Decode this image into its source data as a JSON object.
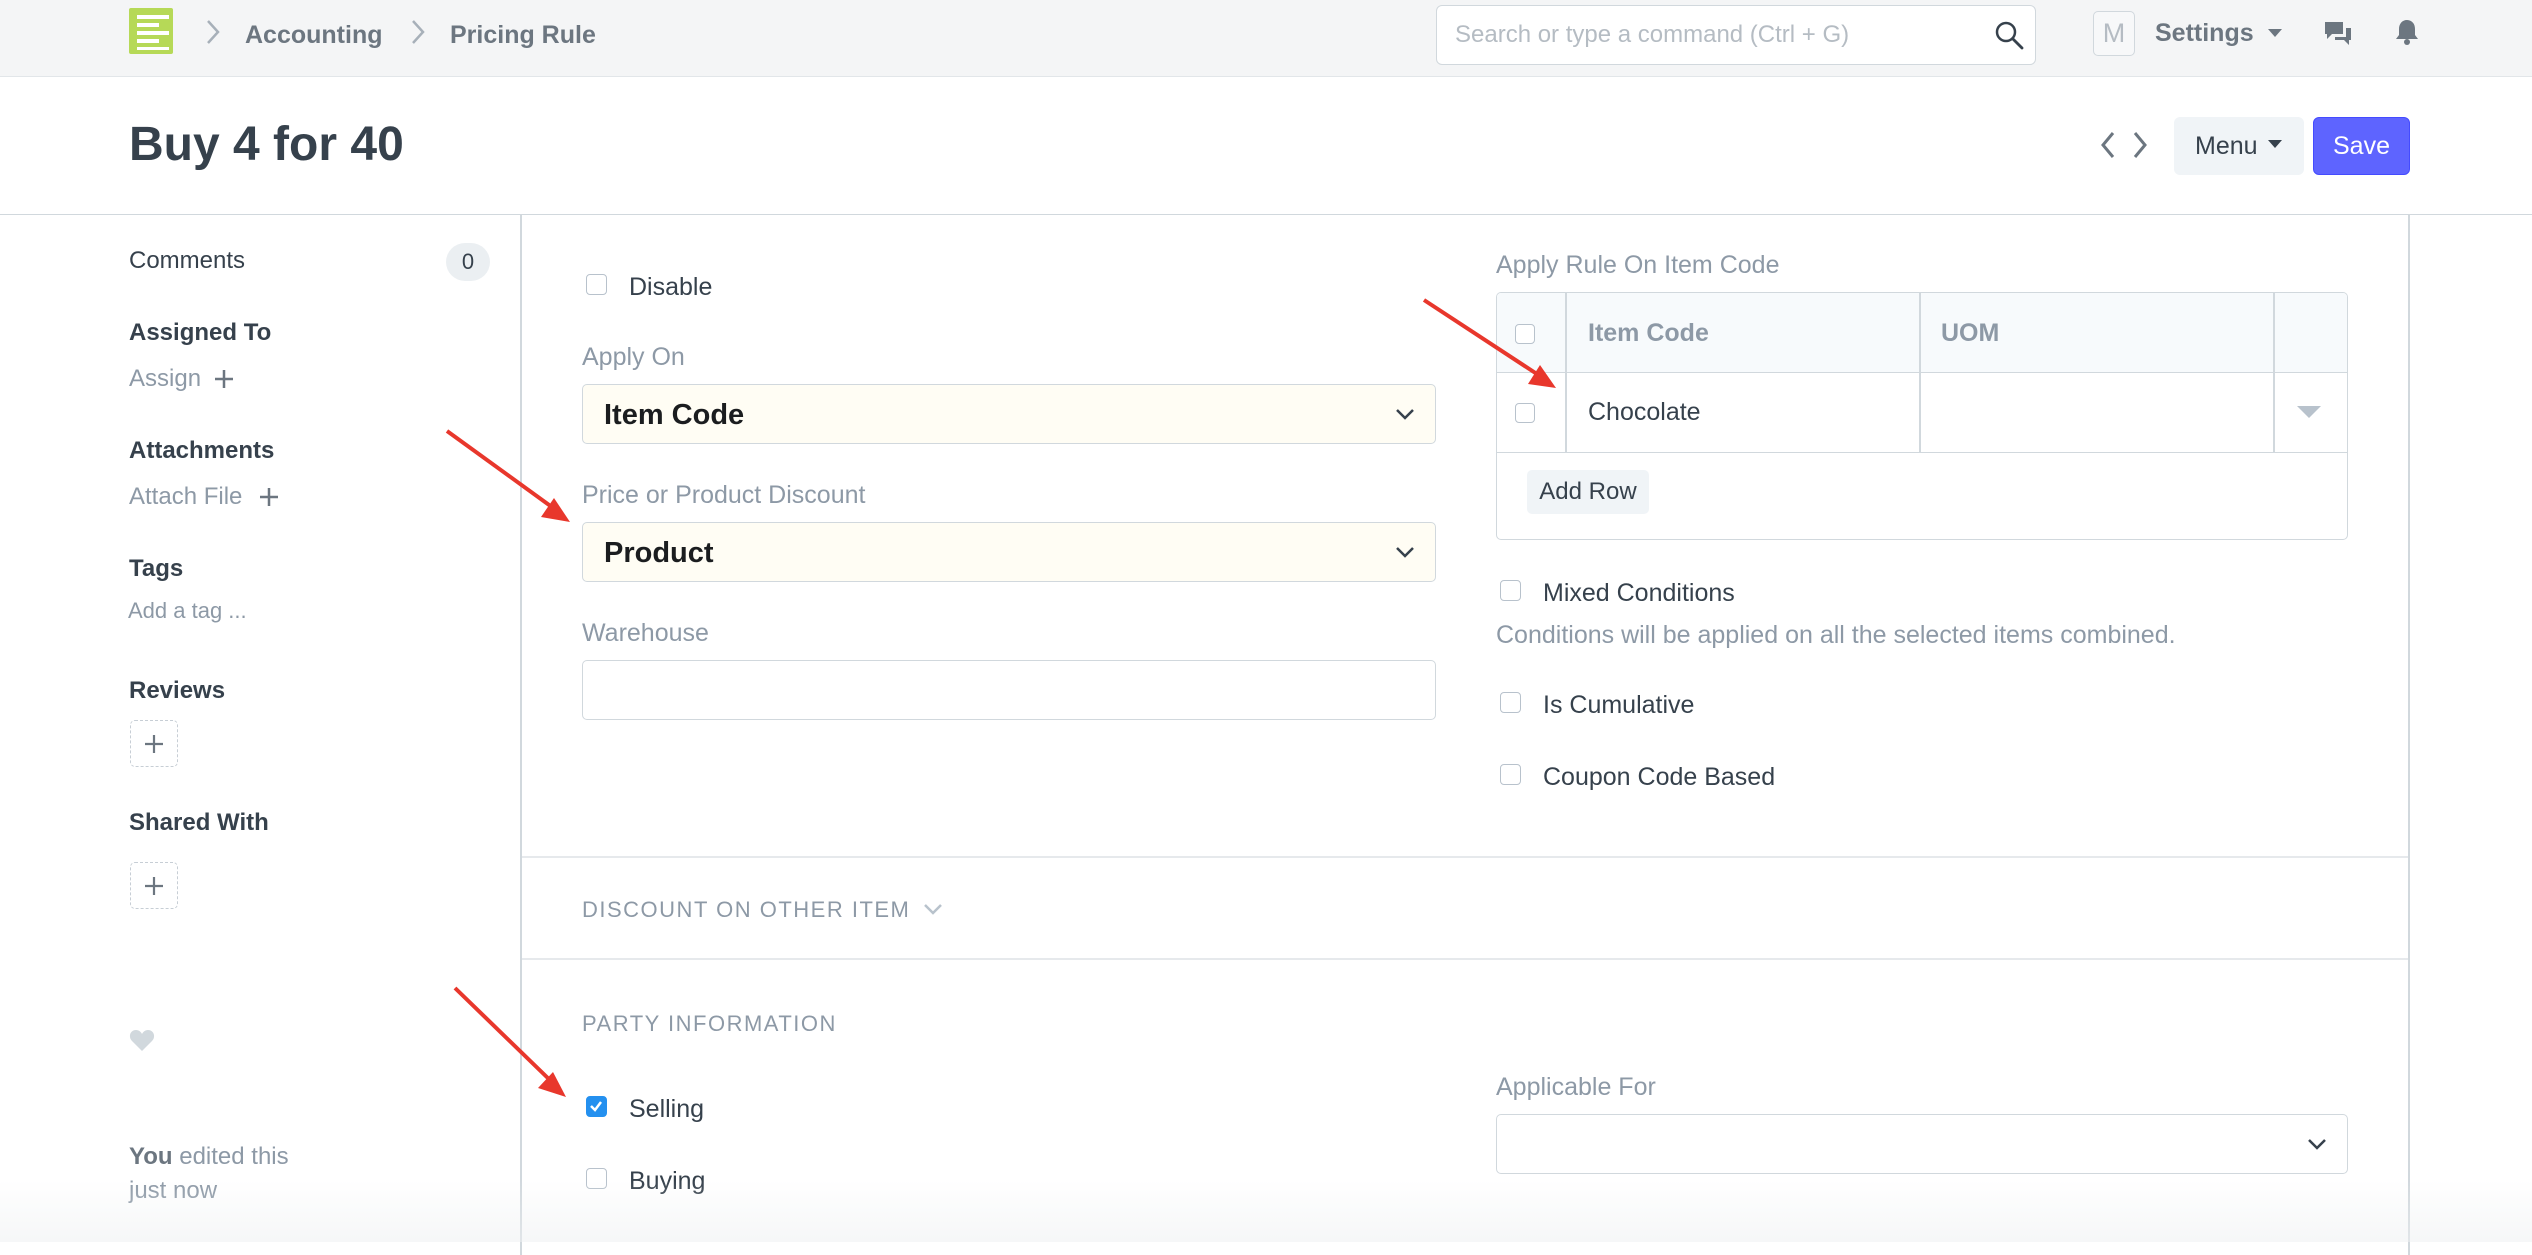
{
  "navbar": {
    "breadcrumbs": [
      "Accounting",
      "Pricing Rule"
    ],
    "search_placeholder": "Search or type a command (Ctrl + G)",
    "avatar_letter": "M",
    "settings_label": "Settings",
    "icons": [
      "app-logo-icon",
      "search-icon",
      "chat-icon",
      "bell-icon"
    ]
  },
  "page": {
    "title": "Buy 4 for 40",
    "menu_label": "Menu",
    "save_label": "Save",
    "accent_color": "#5e64ff"
  },
  "sidebar": {
    "comments_label": "Comments",
    "comments_count": "0",
    "assigned_heading": "Assigned To",
    "assign_link": "Assign",
    "attachments_heading": "Attachments",
    "attach_link": "Attach File",
    "tags_heading": "Tags",
    "tag_placeholder": "Add a tag ...",
    "reviews_heading": "Reviews",
    "shared_heading": "Shared With",
    "edited_user": "You",
    "edited_text": "edited this just now"
  },
  "form": {
    "disable_label": "Disable",
    "disable_checked": false,
    "apply_on_label": "Apply On",
    "apply_on_value": "Item Code",
    "price_or_product_label": "Price or Product Discount",
    "price_or_product_value": "Product",
    "warehouse_label": "Warehouse",
    "warehouse_value": "",
    "apply_rule_label": "Apply Rule On Item Code",
    "grid": {
      "columns": [
        "Item Code",
        "UOM"
      ],
      "rows": [
        {
          "item_code": "Chocolate",
          "uom": ""
        }
      ],
      "add_row_label": "Add Row"
    },
    "mixed_conditions_label": "Mixed Conditions",
    "mixed_conditions_checked": false,
    "mixed_conditions_help": "Conditions will be applied on all the selected items combined.",
    "is_cumulative_label": "Is Cumulative",
    "is_cumulative_checked": false,
    "coupon_label": "Coupon Code Based",
    "coupon_checked": false,
    "discount_section_title": "DISCOUNT ON OTHER ITEM",
    "party_section_title": "PARTY INFORMATION",
    "selling_label": "Selling",
    "selling_checked": true,
    "buying_label": "Buying",
    "buying_checked": false,
    "applicable_for_label": "Applicable For",
    "applicable_for_value": ""
  },
  "annotations": {
    "arrow_color": "#e8372c"
  }
}
